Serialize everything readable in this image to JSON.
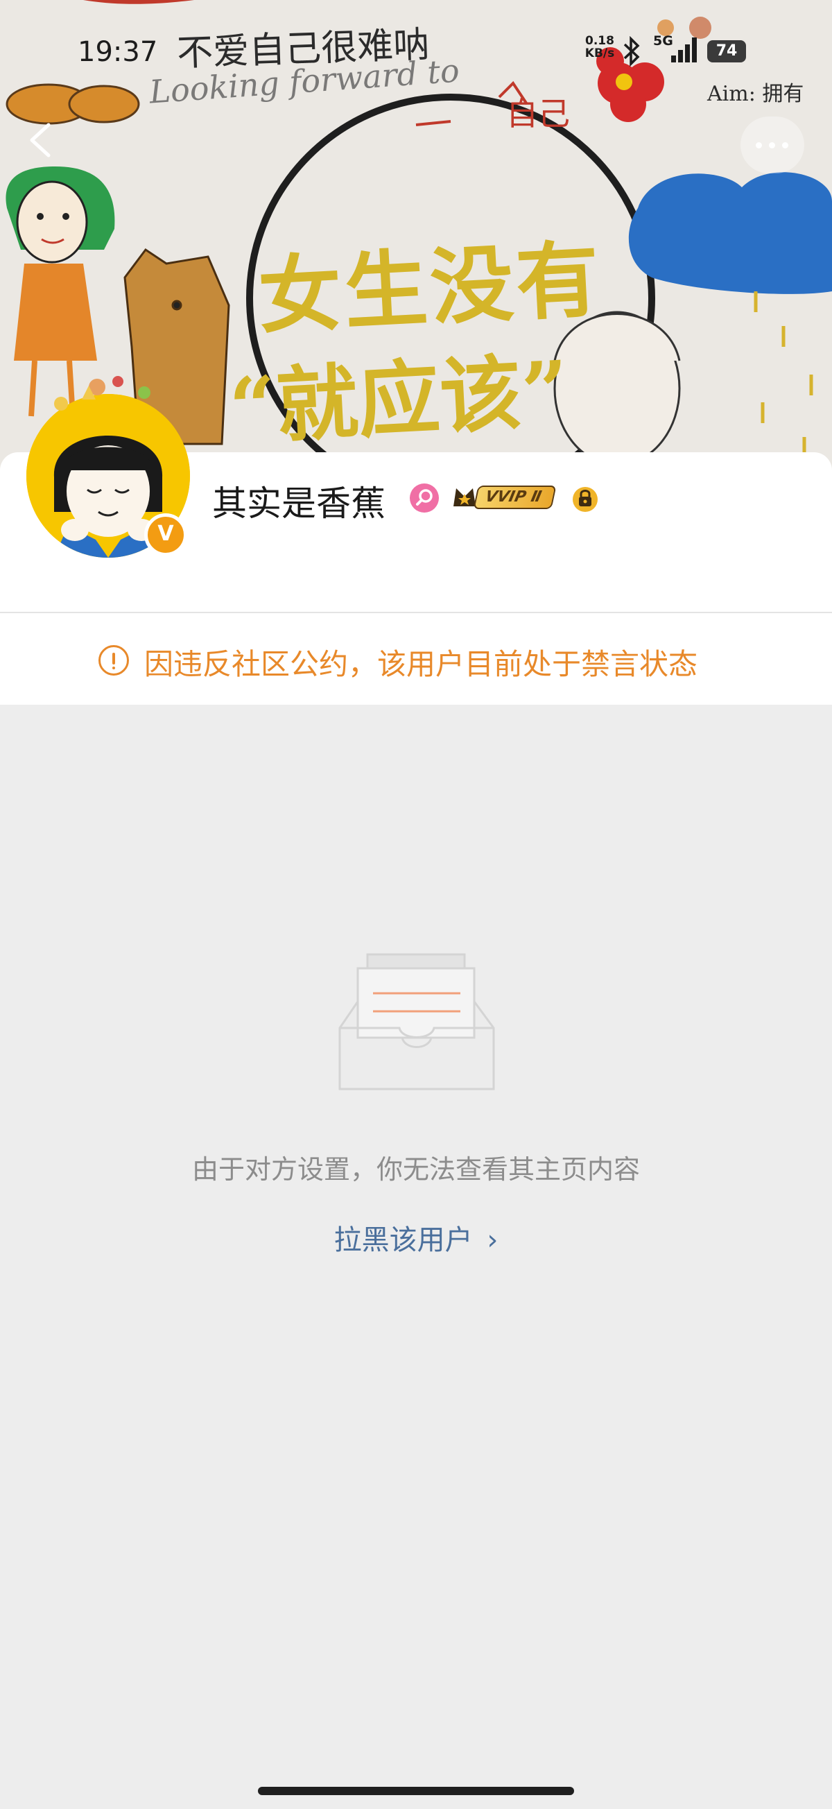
{
  "status_bar": {
    "time": "19:37",
    "net_speed": "0.18",
    "net_unit": "KB/s",
    "network": "5G",
    "battery": "74"
  },
  "cover": {
    "headline_line1": "女生没有",
    "headline_line2": "“就应该”",
    "scribble_1": "不爱自己很难呐",
    "scribble_2": "Looking forward to",
    "scribble_3": "Aim: 拥有",
    "scribble_4": "自己"
  },
  "profile": {
    "name": "其实是香蕉",
    "vip_label": "VVIP Ⅱ",
    "verified_badge": "V"
  },
  "notice": {
    "text": "因违反社区公约，该用户目前处于禁言状态"
  },
  "empty_state": {
    "message": "由于对方设置，你无法查看其主页内容",
    "action_label": "拉黑该用户",
    "action_chevron": "›"
  },
  "icons": {
    "back": "back-arrow-icon",
    "more": "more-dots-icon",
    "notice": "exclamation-circle-icon"
  },
  "colors": {
    "notice": "#e8892a",
    "link": "#4a6f9c",
    "background": "#ededed",
    "vip_gold": "#f0b429"
  }
}
